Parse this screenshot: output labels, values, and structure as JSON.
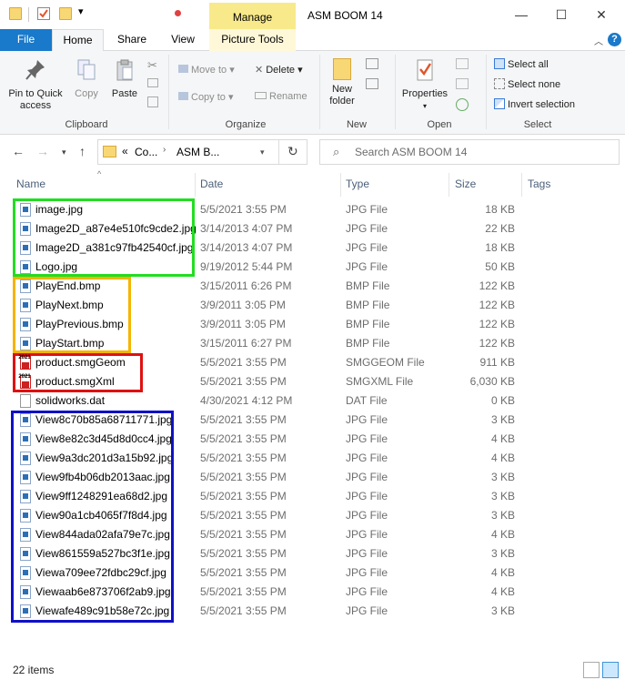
{
  "window": {
    "title": "ASM BOOM 14",
    "manage_label": "Manage",
    "minimize": "—",
    "maximize": "☐",
    "close": "✕"
  },
  "tabs": {
    "file": "File",
    "home": "Home",
    "share": "Share",
    "view": "View",
    "picture_tools": "Picture Tools"
  },
  "ribbon": {
    "clipboard": {
      "label": "Clipboard",
      "pin": "Pin to Quick access",
      "copy": "Copy",
      "paste": "Paste"
    },
    "organize": {
      "label": "Organize",
      "move_to": "Move to",
      "copy_to": "Copy to",
      "delete": "Delete",
      "rename": "Rename"
    },
    "new": {
      "label": "New",
      "new_folder": "New folder"
    },
    "open": {
      "label": "Open",
      "properties": "Properties"
    },
    "select": {
      "label": "Select",
      "select_all": "Select all",
      "select_none": "Select none",
      "invert": "Invert selection"
    }
  },
  "address": {
    "overflow": "«",
    "crumb1": "Co...",
    "crumb2": "ASM B...",
    "search_placeholder": "Search ASM BOOM 14"
  },
  "columns": {
    "name": "Name",
    "date": "Date",
    "type": "Type",
    "size": "Size",
    "tags": "Tags"
  },
  "files": [
    {
      "name": "image.jpg",
      "date": "5/5/2021 3:55 PM",
      "type": "JPG File",
      "size": "18 KB",
      "icon": "image"
    },
    {
      "name": "Image2D_a87e4e510fc9cde2.jpg",
      "date": "3/14/2013 4:07 PM",
      "type": "JPG File",
      "size": "22 KB",
      "icon": "image"
    },
    {
      "name": "Image2D_a381c97fb42540cf.jpg",
      "date": "3/14/2013 4:07 PM",
      "type": "JPG File",
      "size": "18 KB",
      "icon": "image"
    },
    {
      "name": "Logo.jpg",
      "date": "9/19/2012 5:44 PM",
      "type": "JPG File",
      "size": "50 KB",
      "icon": "image"
    },
    {
      "name": "PlayEnd.bmp",
      "date": "3/15/2011 6:26 PM",
      "type": "BMP File",
      "size": "122 KB",
      "icon": "image"
    },
    {
      "name": "PlayNext.bmp",
      "date": "3/9/2011 3:05 PM",
      "type": "BMP File",
      "size": "122 KB",
      "icon": "image"
    },
    {
      "name": "PlayPrevious.bmp",
      "date": "3/9/2011 3:05 PM",
      "type": "BMP File",
      "size": "122 KB",
      "icon": "image"
    },
    {
      "name": "PlayStart.bmp",
      "date": "3/15/2011 6:27 PM",
      "type": "BMP File",
      "size": "122 KB",
      "icon": "image"
    },
    {
      "name": "product.smgGeom",
      "date": "5/5/2021 3:55 PM",
      "type": "SMGGEOM File",
      "size": "911 KB",
      "icon": "smg"
    },
    {
      "name": "product.smgXml",
      "date": "5/5/2021 3:55 PM",
      "type": "SMGXML File",
      "size": "6,030 KB",
      "icon": "smg"
    },
    {
      "name": "solidworks.dat",
      "date": "4/30/2021 4:12 PM",
      "type": "DAT File",
      "size": "0 KB",
      "icon": "plain"
    },
    {
      "name": "View8c70b85a68711771.jpg",
      "date": "5/5/2021 3:55 PM",
      "type": "JPG File",
      "size": "3 KB",
      "icon": "image"
    },
    {
      "name": "View8e82c3d45d8d0cc4.jpg",
      "date": "5/5/2021 3:55 PM",
      "type": "JPG File",
      "size": "4 KB",
      "icon": "image"
    },
    {
      "name": "View9a3dc201d3a15b92.jpg",
      "date": "5/5/2021 3:55 PM",
      "type": "JPG File",
      "size": "4 KB",
      "icon": "image"
    },
    {
      "name": "View9fb4b06db2013aac.jpg",
      "date": "5/5/2021 3:55 PM",
      "type": "JPG File",
      "size": "3 KB",
      "icon": "image"
    },
    {
      "name": "View9ff1248291ea68d2.jpg",
      "date": "5/5/2021 3:55 PM",
      "type": "JPG File",
      "size": "3 KB",
      "icon": "image"
    },
    {
      "name": "View90a1cb4065f7f8d4.jpg",
      "date": "5/5/2021 3:55 PM",
      "type": "JPG File",
      "size": "3 KB",
      "icon": "image"
    },
    {
      "name": "View844ada02afa79e7c.jpg",
      "date": "5/5/2021 3:55 PM",
      "type": "JPG File",
      "size": "4 KB",
      "icon": "image"
    },
    {
      "name": "View861559a527bc3f1e.jpg",
      "date": "5/5/2021 3:55 PM",
      "type": "JPG File",
      "size": "3 KB",
      "icon": "image"
    },
    {
      "name": "Viewa709ee72fdbc29cf.jpg",
      "date": "5/5/2021 3:55 PM",
      "type": "JPG File",
      "size": "4 KB",
      "icon": "image"
    },
    {
      "name": "Viewaab6e873706f2ab9.jpg",
      "date": "5/5/2021 3:55 PM",
      "type": "JPG File",
      "size": "4 KB",
      "icon": "image"
    },
    {
      "name": "Viewafe489c91b58e72c.jpg",
      "date": "5/5/2021 3:55 PM",
      "type": "JPG File",
      "size": "3 KB",
      "icon": "image"
    }
  ],
  "smg_icon_text": "2021",
  "status": {
    "items": "22 items"
  },
  "highlight_colors": {
    "green": "#22dd22",
    "orange": "#f5b400",
    "red": "#e01010",
    "blue": "#1010c8"
  }
}
